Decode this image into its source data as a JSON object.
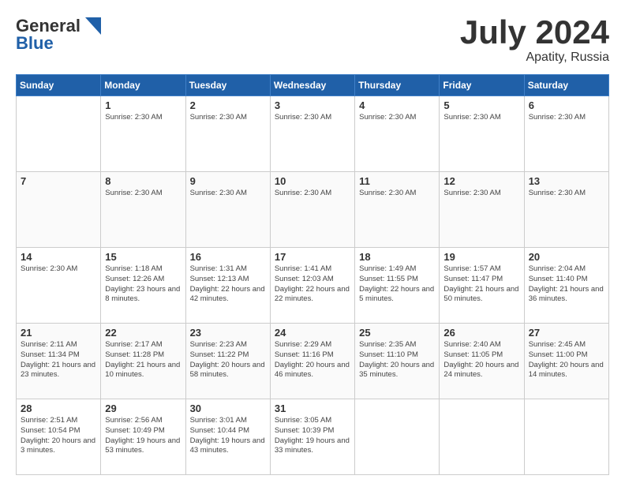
{
  "header": {
    "logo_general": "General",
    "logo_blue": "Blue",
    "month": "July 2024",
    "location": "Apatity, Russia"
  },
  "weekdays": [
    "Sunday",
    "Monday",
    "Tuesday",
    "Wednesday",
    "Thursday",
    "Friday",
    "Saturday"
  ],
  "weeks": [
    [
      {
        "day": null,
        "info": []
      },
      {
        "day": "1",
        "info": [
          "Sunrise: 2:30 AM"
        ]
      },
      {
        "day": "2",
        "info": [
          "Sunrise: 2:30 AM"
        ]
      },
      {
        "day": "3",
        "info": [
          "Sunrise: 2:30 AM"
        ]
      },
      {
        "day": "4",
        "info": [
          "Sunrise: 2:30 AM"
        ]
      },
      {
        "day": "5",
        "info": [
          "Sunrise: 2:30 AM"
        ]
      },
      {
        "day": "6",
        "info": [
          "Sunrise: 2:30 AM"
        ]
      }
    ],
    [
      {
        "day": "7",
        "info": []
      },
      {
        "day": "8",
        "info": [
          "Sunrise: 2:30 AM"
        ]
      },
      {
        "day": "9",
        "info": [
          "Sunrise: 2:30 AM"
        ]
      },
      {
        "day": "10",
        "info": [
          "Sunrise: 2:30 AM"
        ]
      },
      {
        "day": "11",
        "info": [
          "Sunrise: 2:30 AM"
        ]
      },
      {
        "day": "12",
        "info": [
          "Sunrise: 2:30 AM"
        ]
      },
      {
        "day": "13",
        "info": [
          "Sunrise: 2:30 AM"
        ]
      }
    ],
    [
      {
        "day": "14",
        "info": [
          "Sunrise: 2:30 AM"
        ]
      },
      {
        "day": "15",
        "info": [
          "Sunrise: 1:18 AM",
          "Sunset: 12:26 AM",
          "Daylight: 23 hours and 8 minutes."
        ]
      },
      {
        "day": "16",
        "info": [
          "Sunrise: 1:31 AM",
          "Sunset: 12:13 AM",
          "Daylight: 22 hours and 42 minutes."
        ]
      },
      {
        "day": "17",
        "info": [
          "Sunrise: 1:41 AM",
          "Sunset: 12:03 AM",
          "Daylight: 22 hours and 22 minutes."
        ]
      },
      {
        "day": "18",
        "info": [
          "Sunrise: 1:49 AM",
          "Sunset: 11:55 PM",
          "Daylight: 22 hours and 5 minutes."
        ]
      },
      {
        "day": "19",
        "info": [
          "Sunrise: 1:57 AM",
          "Sunset: 11:47 PM",
          "Daylight: 21 hours and 50 minutes."
        ]
      },
      {
        "day": "20",
        "info": [
          "Sunrise: 2:04 AM",
          "Sunset: 11:40 PM",
          "Daylight: 21 hours and 36 minutes."
        ]
      }
    ],
    [
      {
        "day": "21",
        "info": [
          "Sunrise: 2:11 AM",
          "Sunset: 11:34 PM",
          "Daylight: 21 hours and 23 minutes."
        ]
      },
      {
        "day": "22",
        "info": [
          "Sunrise: 2:17 AM",
          "Sunset: 11:28 PM",
          "Daylight: 21 hours and 10 minutes."
        ]
      },
      {
        "day": "23",
        "info": [
          "Sunrise: 2:23 AM",
          "Sunset: 11:22 PM",
          "Daylight: 20 hours and 58 minutes."
        ]
      },
      {
        "day": "24",
        "info": [
          "Sunrise: 2:29 AM",
          "Sunset: 11:16 PM",
          "Daylight: 20 hours and 46 minutes."
        ]
      },
      {
        "day": "25",
        "info": [
          "Sunrise: 2:35 AM",
          "Sunset: 11:10 PM",
          "Daylight: 20 hours and 35 minutes."
        ]
      },
      {
        "day": "26",
        "info": [
          "Sunrise: 2:40 AM",
          "Sunset: 11:05 PM",
          "Daylight: 20 hours and 24 minutes."
        ]
      },
      {
        "day": "27",
        "info": [
          "Sunrise: 2:45 AM",
          "Sunset: 11:00 PM",
          "Daylight: 20 hours and 14 minutes."
        ]
      }
    ],
    [
      {
        "day": "28",
        "info": [
          "Sunrise: 2:51 AM",
          "Sunset: 10:54 PM",
          "Daylight: 20 hours and 3 minutes."
        ]
      },
      {
        "day": "29",
        "info": [
          "Sunrise: 2:56 AM",
          "Sunset: 10:49 PM",
          "Daylight: 19 hours and 53 minutes."
        ]
      },
      {
        "day": "30",
        "info": [
          "Sunrise: 3:01 AM",
          "Sunset: 10:44 PM",
          "Daylight: 19 hours and 43 minutes."
        ]
      },
      {
        "day": "31",
        "info": [
          "Sunrise: 3:05 AM",
          "Sunset: 10:39 PM",
          "Daylight: 19 hours and 33 minutes."
        ]
      },
      {
        "day": null,
        "info": []
      },
      {
        "day": null,
        "info": []
      },
      {
        "day": null,
        "info": []
      }
    ]
  ]
}
